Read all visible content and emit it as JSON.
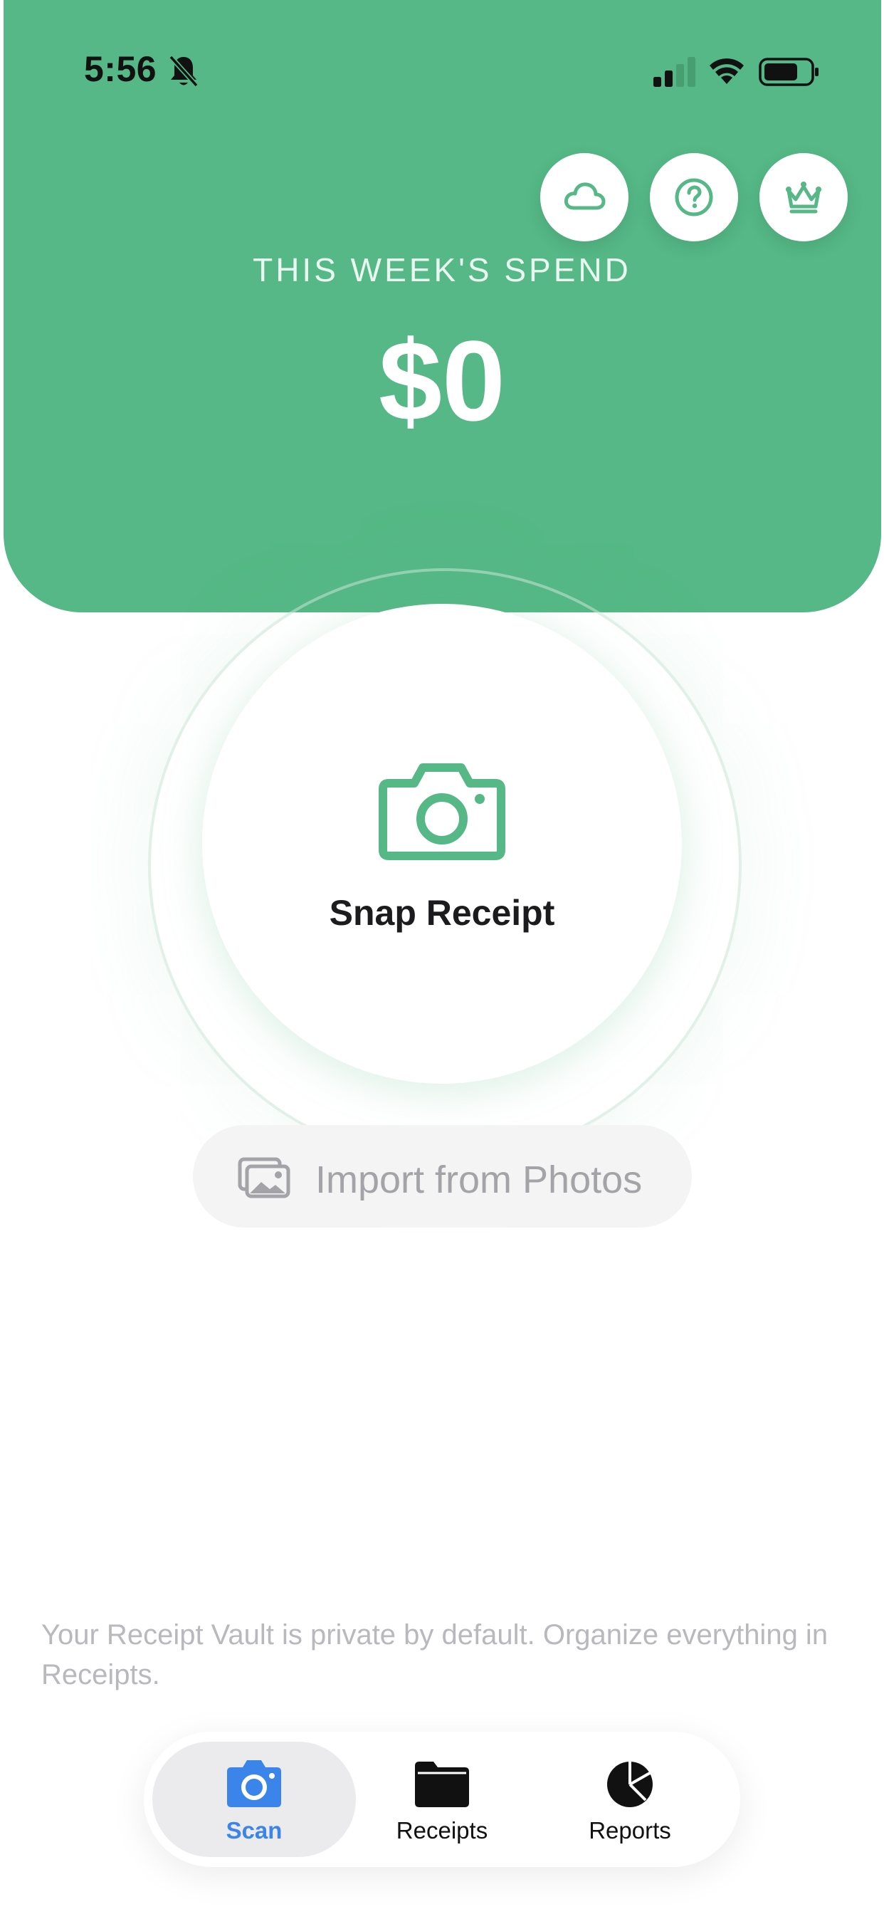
{
  "status_bar": {
    "time": "5:56"
  },
  "header": {
    "title": "THIS WEEK'S SPEND",
    "amount": "$0",
    "buttons": [
      {
        "icon": "cloud-icon"
      },
      {
        "icon": "help-circle-icon"
      },
      {
        "icon": "crown-icon"
      }
    ]
  },
  "snap": {
    "label": "Snap Receipt",
    "icon": "camera-icon"
  },
  "import": {
    "label": "Import from Photos",
    "icon": "photos-icon"
  },
  "footer": {
    "note": "Your Receipt Vault is private by default. Organize everything in Receipts."
  },
  "tabs": [
    {
      "label": "Scan",
      "icon": "camera-icon",
      "active": true
    },
    {
      "label": "Receipts",
      "icon": "folder-icon",
      "active": false
    },
    {
      "label": "Reports",
      "icon": "pie-chart-icon",
      "active": false
    }
  ],
  "colors": {
    "brand_green": "#55b886",
    "active_tab": "#3a84ea",
    "muted_text": "#a3a3a8"
  }
}
